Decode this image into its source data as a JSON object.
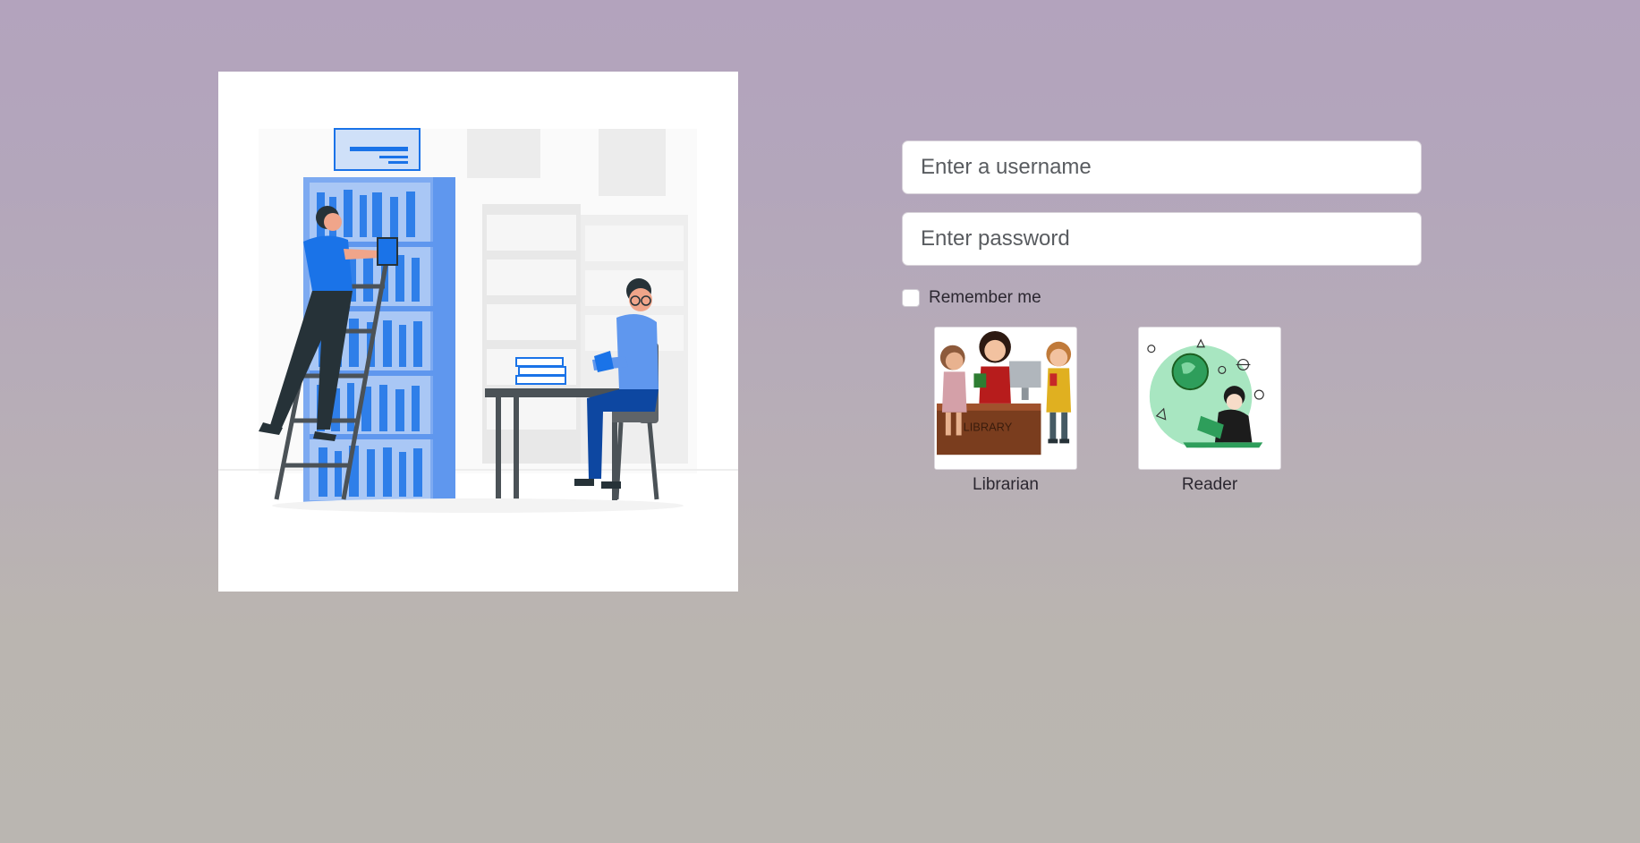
{
  "login": {
    "username_placeholder": "Enter a username",
    "username_value": "",
    "password_placeholder": "Enter password",
    "password_value": "",
    "remember_label": "Remember me",
    "remember_checked": false
  },
  "roles": [
    {
      "label": "Librarian",
      "image_text": "LIBRARY"
    },
    {
      "label": "Reader"
    }
  ],
  "colors": {
    "accent_blue": "#1a73e8",
    "page_top": "#b3a3bd",
    "page_bottom": "#bab6b1"
  }
}
